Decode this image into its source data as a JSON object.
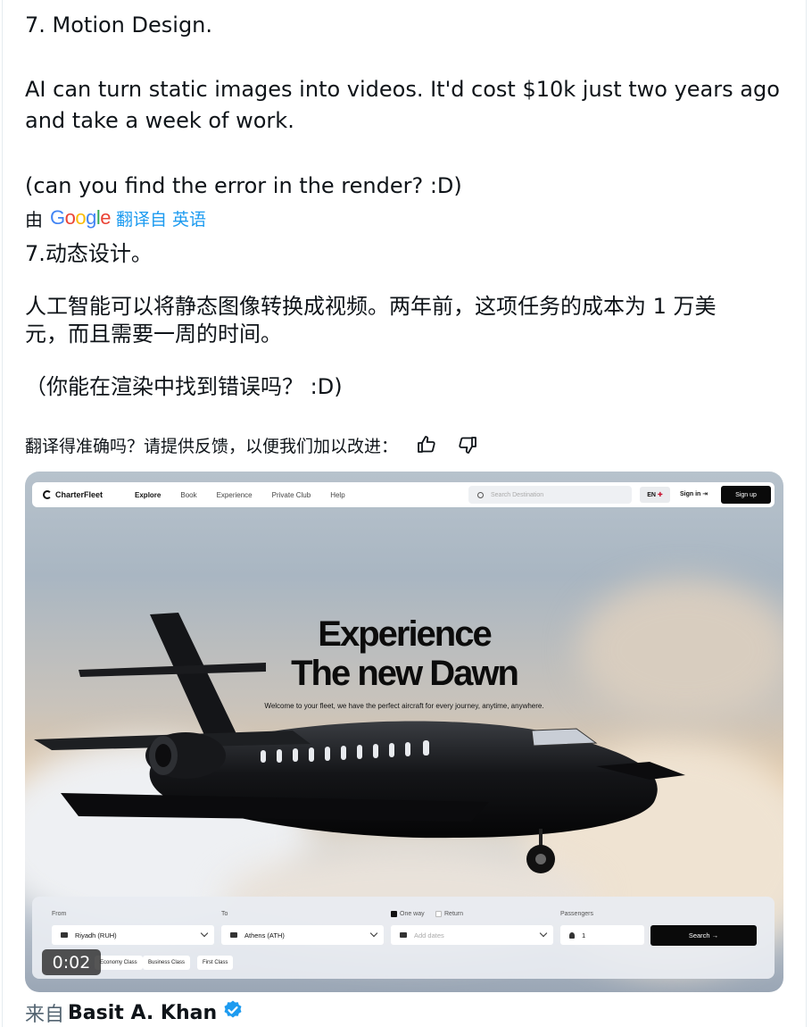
{
  "tweet": {
    "line1": "7. Motion Design.",
    "line2": "AI can turn static images into videos. It'd cost $10k just two years ago",
    "line3": "and take a week of work.",
    "line4": "(can you find the error in the render? :D)"
  },
  "translation": {
    "by_label": "由",
    "provider": "Google",
    "link_text": "翻译自 英语",
    "zh_line1": "7.动态设计。",
    "zh_line2": "人工智能可以将静态图像转换成视频。两年前，这项任务的成本为 1 万美",
    "zh_line3": "元，而且需要一周的时间。",
    "zh_line4": "（你能在渲染中找到错误吗？ :D)",
    "feedback_prompt": "翻译得准确吗？请提供反馈，以便我们加以改进："
  },
  "media": {
    "app_name": "CharterFleet",
    "nav_links": [
      "Explore",
      "Book",
      "Experience",
      "Private Club",
      "Help"
    ],
    "search_placeholder": "Search Destination",
    "language": "EN",
    "sign_in": "Sign in",
    "sign_up": "Sign up",
    "headline1": "Experience",
    "headline2": "The new Dawn",
    "subtitle": "Welcome to your fleet, we have the perfect aircraft for every journey, anytime, anywhere.",
    "booking": {
      "from_label": "From",
      "from_value": "Riyadh (RUH)",
      "to_label": "To",
      "to_value": "Athens (ATH)",
      "one_way": "One way",
      "return": "Return",
      "dates_placeholder": "Add dates",
      "passengers_label": "Passengers",
      "passengers_value": "1",
      "search_button": "Search →",
      "classes": [
        "Economy Class",
        "Business Class",
        "First Class"
      ]
    },
    "timecode": "0:02"
  },
  "source": {
    "from_label": "来自",
    "author": "Basit A. Khan"
  },
  "colors": {
    "link": "#1d9bf0",
    "verified": "#1d9bf0",
    "text": "#0f1419",
    "muted": "#536471"
  }
}
